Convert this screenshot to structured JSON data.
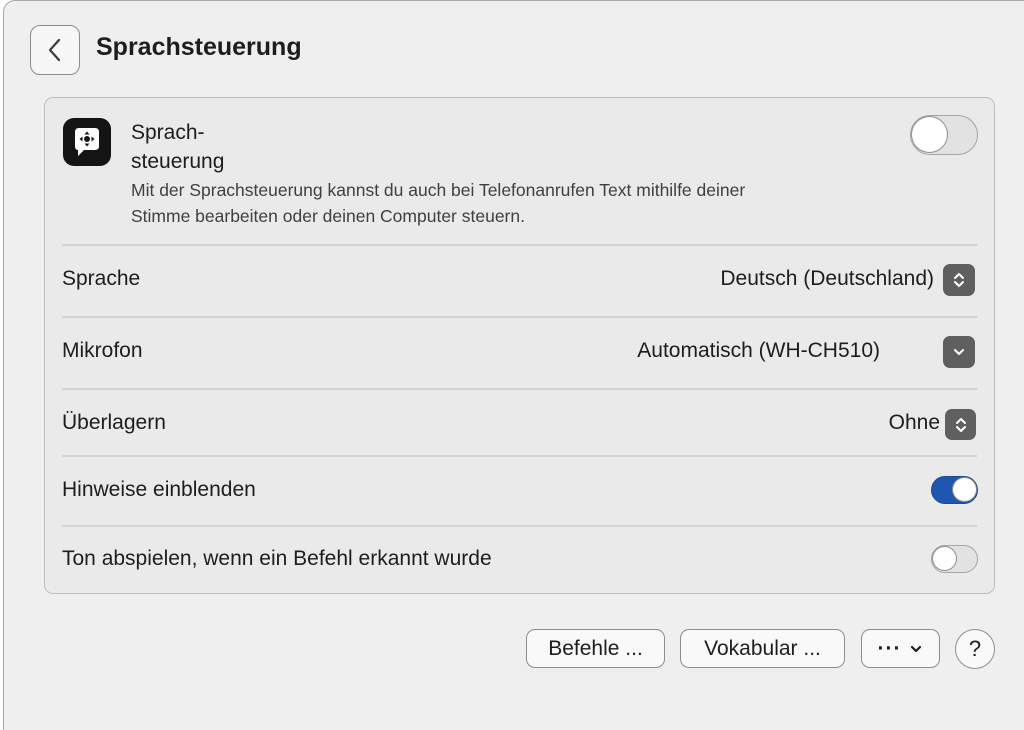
{
  "header": {
    "title": "Sprachsteuerung",
    "back_icon": "chevron-left-icon"
  },
  "feature": {
    "icon": "voice-control-icon",
    "name_line1": "Sprach-",
    "name_line2": "steuerung",
    "description_line1": "Mit der Sprachsteuerung kannst du auch bei Telefonanrufen Text mithilfe deiner",
    "description_line2": "Stimme bearbeiten oder deinen Computer steuern.",
    "enabled": false
  },
  "settings": {
    "language": {
      "label": "Sprache",
      "value": "Deutsch (Deutschland)",
      "control_icon": "up-down-chevron-icon"
    },
    "microphone": {
      "label": "Mikrofon",
      "value": "Automatisch (WH-CH510)",
      "control_icon": "chevron-down-icon"
    },
    "overlay": {
      "label": "Überlagern",
      "value": "Ohne",
      "control_icon": "up-down-chevron-icon"
    },
    "show_hints": {
      "label": "Hinweise einblenden",
      "enabled": true
    },
    "play_sound": {
      "label": "Ton abspielen, wenn ein Befehl erkannt wurde",
      "enabled": false
    }
  },
  "footer": {
    "commands_label": "Befehle ...",
    "vocabulary_label": "Vokabular ...",
    "more_label": "···",
    "more_icon": "chevron-down-icon",
    "help_label": "?"
  },
  "colors": {
    "accent": "#1f56b0",
    "window_background": "#f0efef",
    "group_background": "#ebeaea",
    "toggle_off": "#e2e2e2",
    "stepper_background": "#5f5f5f"
  }
}
